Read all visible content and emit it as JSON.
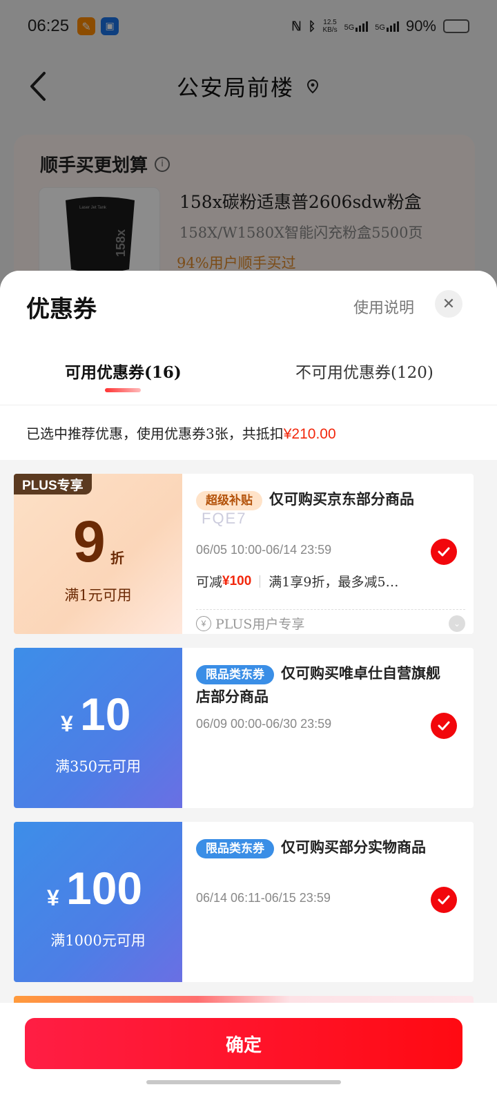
{
  "status_bar": {
    "time": "06:25",
    "app1_icon": "orange-app-icon",
    "app2_icon": "blue-app-icon",
    "net_speed": "12.5",
    "net_unit": "KB/s",
    "sig1": "5G",
    "sig2": "5G",
    "battery": "90%"
  },
  "nav": {
    "title": "公安局前楼",
    "back_icon": "back-arrow-icon",
    "location_icon": "location-pin-icon"
  },
  "recommend_card": {
    "title": "顺手买更划算",
    "product_name": "158x碳粉适惠普2606sdw粉盒",
    "product_sub": "158X/W1580X智能闪充粉盒5500页",
    "product_pct": "94%用户顺手买过",
    "product_image_text": "158x",
    "product_image_caption": "Laser Jet Tank"
  },
  "sheet": {
    "title": "优惠券",
    "help": "使用说明",
    "close_icon": "close-icon",
    "tab_available": "可用优惠券(16)",
    "tab_unavailable": "不可用优惠券(120)",
    "summary_text": "已选中推荐优惠，使用优惠券3张，共抵扣",
    "summary_amount": "¥210.00"
  },
  "coupons": [
    {
      "plus_tag": "PLUS专享",
      "value": "9",
      "unit": "折",
      "condition": "满1元可用",
      "tag": "超级补贴",
      "title": "仅可购买京东部分商品",
      "code": "FQE7",
      "date": "06/05 10:00-06/14 23:59",
      "detail_prefix": "可减",
      "detail_amount": "¥100",
      "detail_rest": "满1享9折，最多减5…",
      "plus_text": "PLUS用户专享",
      "selected": true
    },
    {
      "currency": "¥",
      "value": "10",
      "condition": "满350元可用",
      "tag": "限品类东券",
      "title": "仅可购买唯卓仕自营旗舰店部分商品",
      "date": "06/09 00:00-06/30 23:59",
      "selected": true
    },
    {
      "currency": "¥",
      "value": "100",
      "condition": "满1000元可用",
      "tag": "限品类东券",
      "title": "仅可购买部分实物商品",
      "date": "06/14 06:11-06/15 23:59",
      "selected": true
    }
  ],
  "footer": {
    "confirm": "确定"
  },
  "colors": {
    "accent_red": "#f2070c",
    "price_red": "#f2270c",
    "blue_coupon": "#4d7ee6",
    "orange_coupon": "#fbd6b9",
    "plus_brown": "#5b3a20"
  }
}
